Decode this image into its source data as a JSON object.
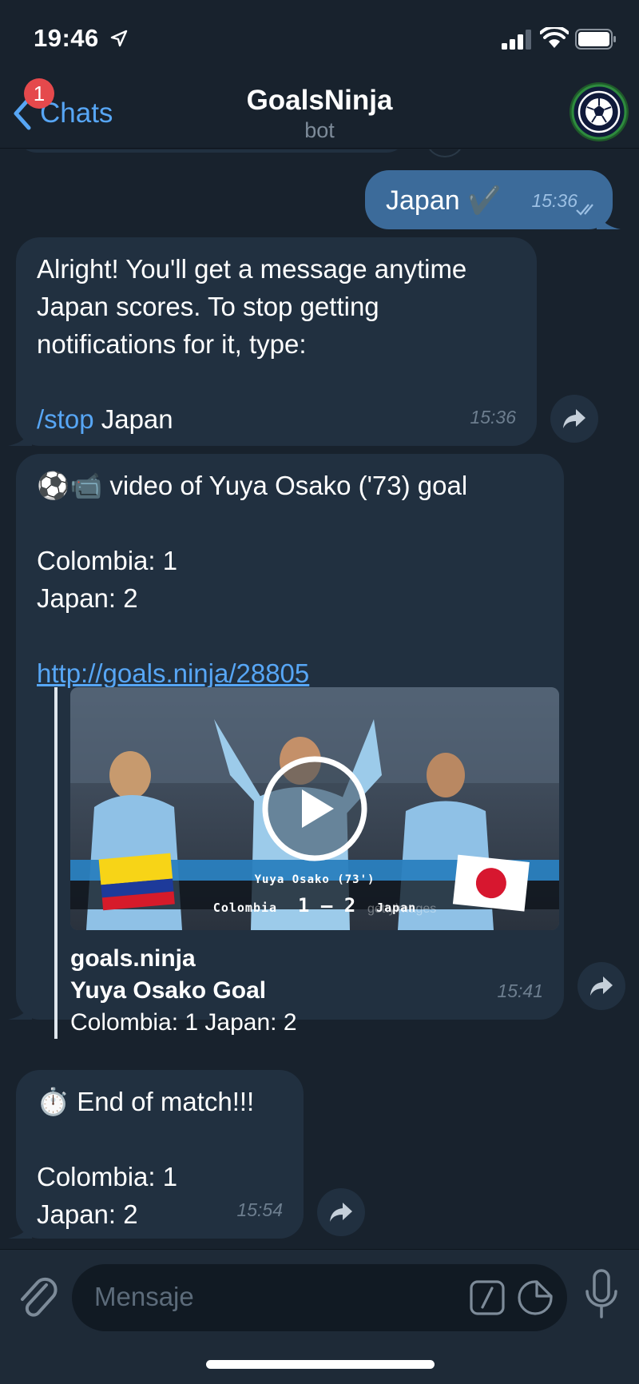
{
  "status_bar": {
    "time": "19:46"
  },
  "header": {
    "back_label": "Chats",
    "unread_badge": "1",
    "title": "GoalsNinja",
    "subtitle": "bot"
  },
  "messages": {
    "m1": {
      "text": "Japan ✔️",
      "time": "15:36"
    },
    "m2": {
      "line1": "Alright! You'll get a message anytime",
      "line2": "Japan scores. To stop getting",
      "line3": "notifications for it, type:",
      "command": "/stop",
      "command_arg": " Japan",
      "time": "15:36"
    },
    "m3": {
      "line1": "⚽📹 video of Yuya Osako ('73) goal",
      "line2": "Colombia: 1",
      "line3": "Japan: 2",
      "link": "http://goals.ninja/28805",
      "preview": {
        "site": "goals.ninja",
        "title": "Yuya Osako Goal",
        "description": "Colombia: 1 Japan: 2",
        "scorer_banner": "Yuya Osako (73')",
        "home_team": "Colombia",
        "score": "1 – 2",
        "away_team": "Japan",
        "watermark": "gettyimages"
      },
      "time": "15:41"
    },
    "m4": {
      "line1": "⏱️ End of match!!!",
      "line2": "Colombia: 1",
      "line3": "Japan: 2",
      "time": "15:54"
    }
  },
  "input": {
    "placeholder": "Mensaje"
  },
  "colors": {
    "background": "#18222d",
    "bubble_in": "#213040",
    "bubble_out": "#3c6b9a",
    "accent": "#57a6f5",
    "badge": "#e5494c"
  }
}
